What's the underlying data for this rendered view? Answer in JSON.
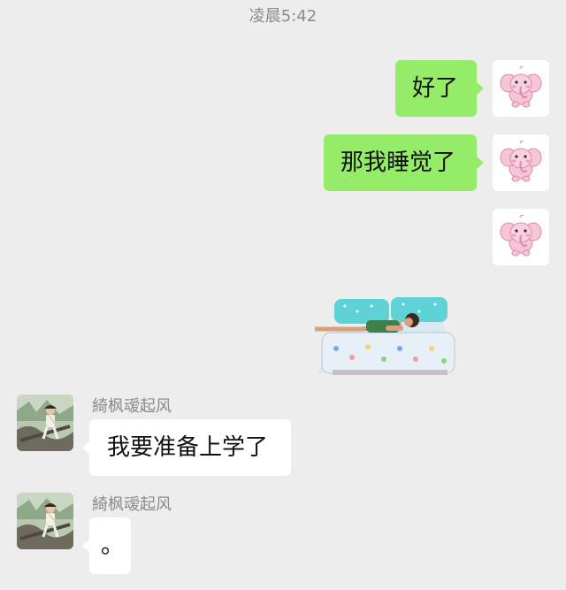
{
  "chat": {
    "timestamp": "凌晨5:42",
    "messages": [
      {
        "direction": "outgoing",
        "text": "好了"
      },
      {
        "direction": "outgoing",
        "text": "那我睡觉了"
      },
      {
        "direction": "outgoing",
        "type": "sticker",
        "sticker": "pink-elephant-icon"
      },
      {
        "direction": "outgoing",
        "type": "sticker",
        "sticker": "person-lying-on-bed-sticker"
      },
      {
        "direction": "incoming",
        "sender": "綺枫叆起风",
        "text": "我要准备上学了"
      },
      {
        "direction": "incoming",
        "sender": "綺枫叆起风",
        "text": "。"
      }
    ]
  },
  "icons": {
    "self_avatar": "pink-elephant-icon",
    "contact_avatar": "photo-avatar"
  },
  "colors": {
    "background": "#ededed",
    "outgoing_bubble": "#95ec69",
    "incoming_bubble": "#ffffff",
    "meta_text": "#8a8a8a"
  }
}
